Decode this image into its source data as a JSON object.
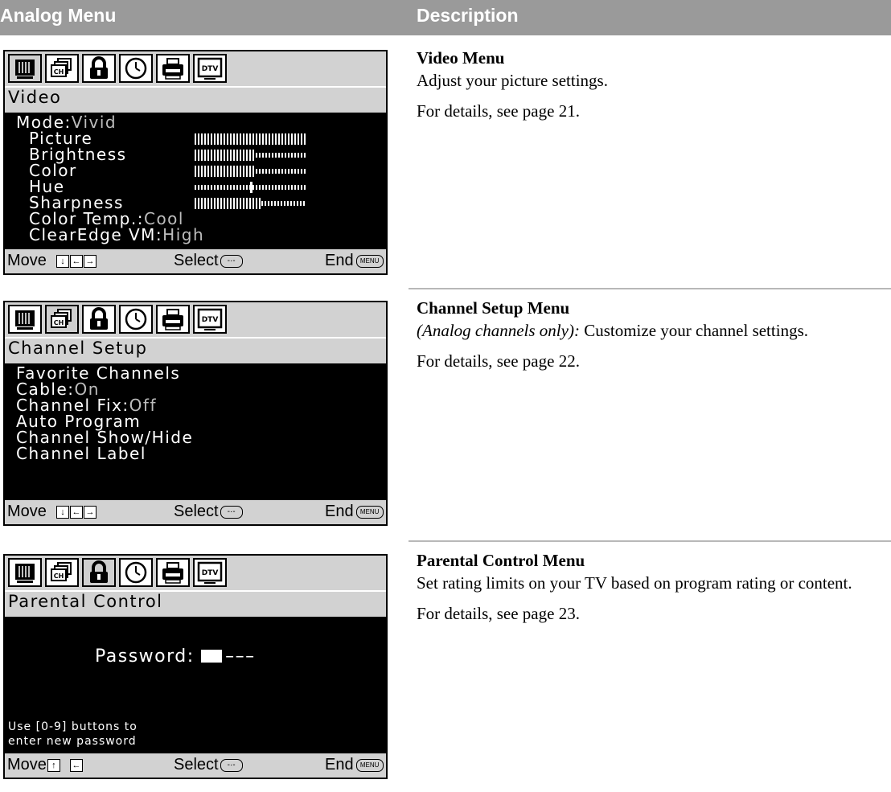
{
  "header": {
    "left": "Analog Menu",
    "right": "Description"
  },
  "icons": [
    "tv-screen-icon",
    "channel-icon",
    "lock-icon",
    "clock-icon",
    "setup-icon",
    "dtv-icon"
  ],
  "icon_text": {
    "channel": "CH",
    "dtv": "DTV"
  },
  "footer_common": {
    "move": "Move",
    "select": "Select",
    "end": "End",
    "menu_btn": "MENU",
    "enter": "-·-"
  },
  "video": {
    "title": "Video",
    "mode_label": "Mode:",
    "mode_value": "Vivid",
    "items": [
      "Picture",
      "Brightness",
      "Color",
      "Hue",
      "Sharpness"
    ],
    "levels": [
      1.0,
      0.55,
      0.55,
      0.5,
      0.6
    ],
    "color_temp_label": "Color Temp.:",
    "color_temp_value": "Cool",
    "clearedge_label": "ClearEdge VM:",
    "clearedge_value": "High",
    "desc_heading": "Video Menu",
    "desc_text": "Adjust your picture settings.",
    "desc_ref": "For details, see page 21."
  },
  "channel": {
    "title": "Channel Setup",
    "favorite": "Favorite Channels",
    "cable_label": "Cable:",
    "cable_value": "On",
    "fix_label": "Channel Fix:",
    "fix_value": "Off",
    "auto": "Auto Program",
    "showhide": "Channel Show/Hide",
    "label": "Channel Label",
    "desc_heading": "Channel Setup Menu",
    "desc_italic": "(Analog channels only):",
    "desc_text": " Customize your channel settings.",
    "desc_ref": "For details, see page 22."
  },
  "parental": {
    "title": "Parental Control",
    "password_label": "Password:",
    "password_dashes": "–––",
    "hint_line1": "Use [0-9] buttons to",
    "hint_line2": "enter new password",
    "desc_heading": "Parental Control Menu",
    "desc_text": "Set rating limits on your TV based on program rating or content.",
    "desc_ref": "For details, see page 23."
  },
  "colors": {
    "header_bg": "#9a9a9a",
    "menu_panel": "#d2d2d2",
    "value_gray": "#bdbdbd"
  }
}
